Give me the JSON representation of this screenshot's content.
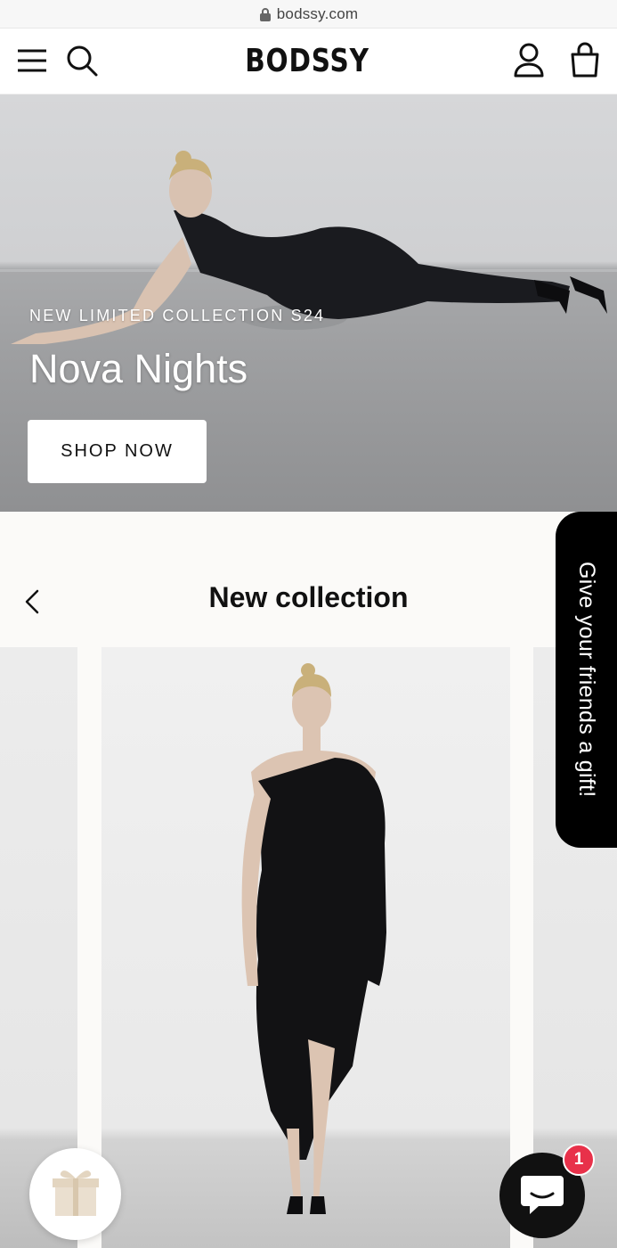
{
  "browser": {
    "url": "bodssy.com"
  },
  "header": {
    "logo": "BODSSY",
    "icons": [
      "menu-icon",
      "search-icon",
      "account-icon",
      "cart-icon"
    ]
  },
  "hero": {
    "eyebrow": "NEW LIMITED COLLECTION S24",
    "title": "Nova Nights",
    "cta_label": "SHOP NOW"
  },
  "collection": {
    "title": "New collection",
    "nav_icon": "chevron-left-icon"
  },
  "gift_tab": {
    "label": "Give your friends a gift!"
  },
  "chat": {
    "badge_count": "1"
  },
  "colors": {
    "accent_badge": "#e8314a",
    "header_bg": "#ffffff",
    "page_bg": "#fbfaf8",
    "dark": "#111111"
  }
}
